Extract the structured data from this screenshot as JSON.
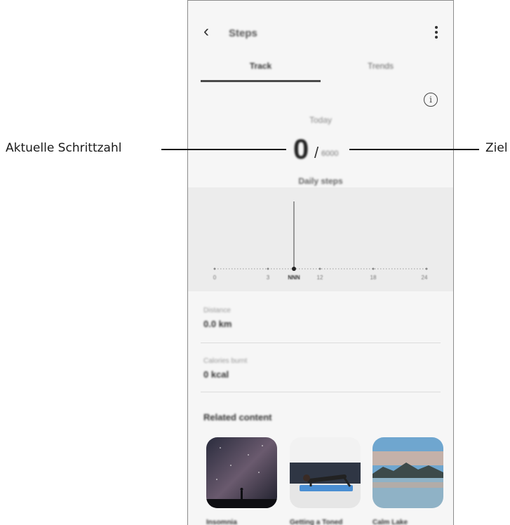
{
  "app": {
    "title": "Steps",
    "tabs": [
      {
        "label": "Track",
        "active": true
      },
      {
        "label": "Trends",
        "active": false
      }
    ]
  },
  "summary": {
    "day_label": "Today",
    "steps_current": "0",
    "steps_separator": "/",
    "steps_goal": "6000",
    "daily_label": "Daily steps"
  },
  "chart": {
    "tick_labels": [
      "0",
      "3",
      "NNN",
      "12",
      "18",
      "24"
    ]
  },
  "stats": {
    "distance_label": "Distance",
    "distance_value": "0.0 km",
    "calories_label": "Calories burnt",
    "calories_value": "0 kcal"
  },
  "related": {
    "heading": "Related content",
    "items": [
      {
        "label": "Insomnia"
      },
      {
        "label": "Getting a Toned"
      },
      {
        "label": "Calm Lake"
      }
    ]
  },
  "callouts": {
    "current_steps": "Aktuelle Schrittzahl",
    "goal": "Ziel"
  },
  "icons": {
    "back": "back-arrow-icon",
    "more": "more-options-icon",
    "info": "info-icon"
  }
}
